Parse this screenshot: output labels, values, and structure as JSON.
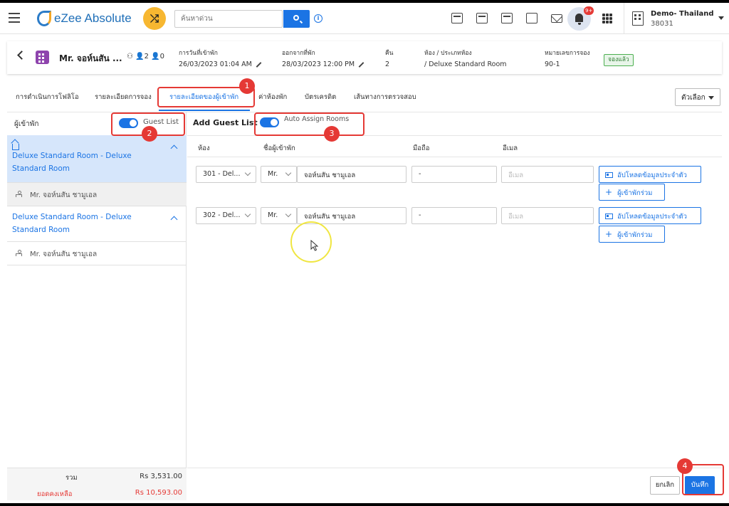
{
  "app": {
    "name": "eZee Absolute",
    "search_placeholder": "ค้นหาด่วน",
    "notif_count": "9+",
    "property_name": "Demo- Thailand",
    "property_code": "38031"
  },
  "booking": {
    "guest_name": "Mr. จอห์นสัน ...",
    "adults": "2",
    "children": "0",
    "checkin_label": "การวันที่เข้าพัก",
    "checkin_value": "26/03/2023 01:04 AM",
    "checkout_label": "ออกจากที่พัก",
    "checkout_value": "28/03/2023 12:00 PM",
    "nights_label": "คืน",
    "nights_value": "2",
    "room_label": "ห้อง / ประเภทห้อง",
    "room_value": "/ Deluxe Standard Room",
    "res_no_label": "หมายเลขการจอง",
    "res_no_value": "90-1",
    "status": "จองแล้ว"
  },
  "tabs": [
    {
      "label": "การดำเนินการโฟลิโอ"
    },
    {
      "label": "รายละเอียดการจอง"
    },
    {
      "label": "รายละเอียดของผู้เข้าพัก"
    },
    {
      "label": "ค่าห้องพัก"
    },
    {
      "label": "บัตรเครดิต"
    },
    {
      "label": "เส้นทางการตรวจสอบ"
    }
  ],
  "options_label": "ตัวเลือก",
  "left_panel": {
    "title": "ผู้เข้าพัก",
    "guest_list_label": "Guest List",
    "rooms": [
      {
        "name": "Deluxe Standard Room - Deluxe Standard Room",
        "guest": "Mr. จอห์นสัน ชามูเอล"
      },
      {
        "name": "Deluxe Standard Room - Deluxe Standard Room",
        "guest": "Mr. จอห์นสัน ชามูเอล"
      }
    ],
    "total_label": "รวม",
    "total_value": "Rs 3,531.00",
    "balance_label": "ยอดคงเหลือ",
    "balance_value": "Rs 10,593.00"
  },
  "right_panel": {
    "title": "Add Guest List",
    "auto_assign_label": "Auto Assign Rooms",
    "columns": [
      "ห้อง",
      "ชื่อผู้เข้าพัก",
      "มือถือ",
      "อีเมล"
    ],
    "rows": [
      {
        "room": "301 - Del...",
        "salutation": "Mr.",
        "name": "จอห์นสัน ชามูเอล",
        "mobile": "-",
        "email_placeholder": "อีเมล",
        "upload_label": "อัปโหลดข้อมูลประจำตัว",
        "add_label": "ผู้เข้าพักร่วม"
      },
      {
        "room": "302 - Del...",
        "salutation": "Mr.",
        "name": "จอห์นสัน ชามูเอล",
        "mobile": "-",
        "email_placeholder": "อีเมล",
        "upload_label": "อัปโหลดข้อมูลประจำตัว",
        "add_label": "ผู้เข้าพักร่วม"
      }
    ]
  },
  "footer": {
    "cancel_label": "ยกเลิก",
    "save_label": "บันทึก"
  },
  "annotations": [
    "1",
    "2",
    "3",
    "4"
  ],
  "colors": {
    "primary": "#1b74e4",
    "highlight": "#e53935",
    "selected_room_bg": "#d6e6fb",
    "balance": "#e53935"
  }
}
